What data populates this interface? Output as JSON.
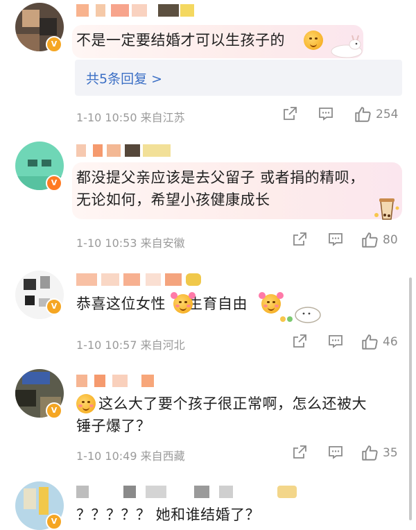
{
  "comments": [
    {
      "text_lines": [
        "不是一定要结婚才可以生孩子的"
      ],
      "replies_label": "共5条回复 >",
      "time": "1-10 10:50",
      "location": "来自江苏",
      "likes": "254"
    },
    {
      "text_lines": [
        "都没提父亲应该是去父留子  或者捐的精呗，",
        "无论如何，希望小孩健康成长"
      ],
      "time": "1-10 10:53",
      "location": "来自安徽",
      "likes": "80"
    },
    {
      "text_lines": [
        "恭喜这位女性",
        "生育自由"
      ],
      "time": "1-10 10:57",
      "location": "来自河北",
      "likes": "46"
    },
    {
      "text_lines": [
        "这么大了要个孩子很正常啊，怎么还被大",
        "锤子爆了？"
      ],
      "time": "1-10 10:49",
      "location": "来自西藏",
      "likes": "35"
    },
    {
      "text_lines": [
        "？？？？？ 她和谁结婚了？"
      ]
    }
  ],
  "badges": {
    "verified": "V"
  },
  "icons": {
    "forward": "share-square-icon",
    "comment": "comment-bubble-icon",
    "like": "thumbs-up-icon"
  },
  "colors": {
    "reply_link": "#3b6fc5",
    "meta_text": "#9a9a9a",
    "badge_gold": "#f5a623"
  }
}
